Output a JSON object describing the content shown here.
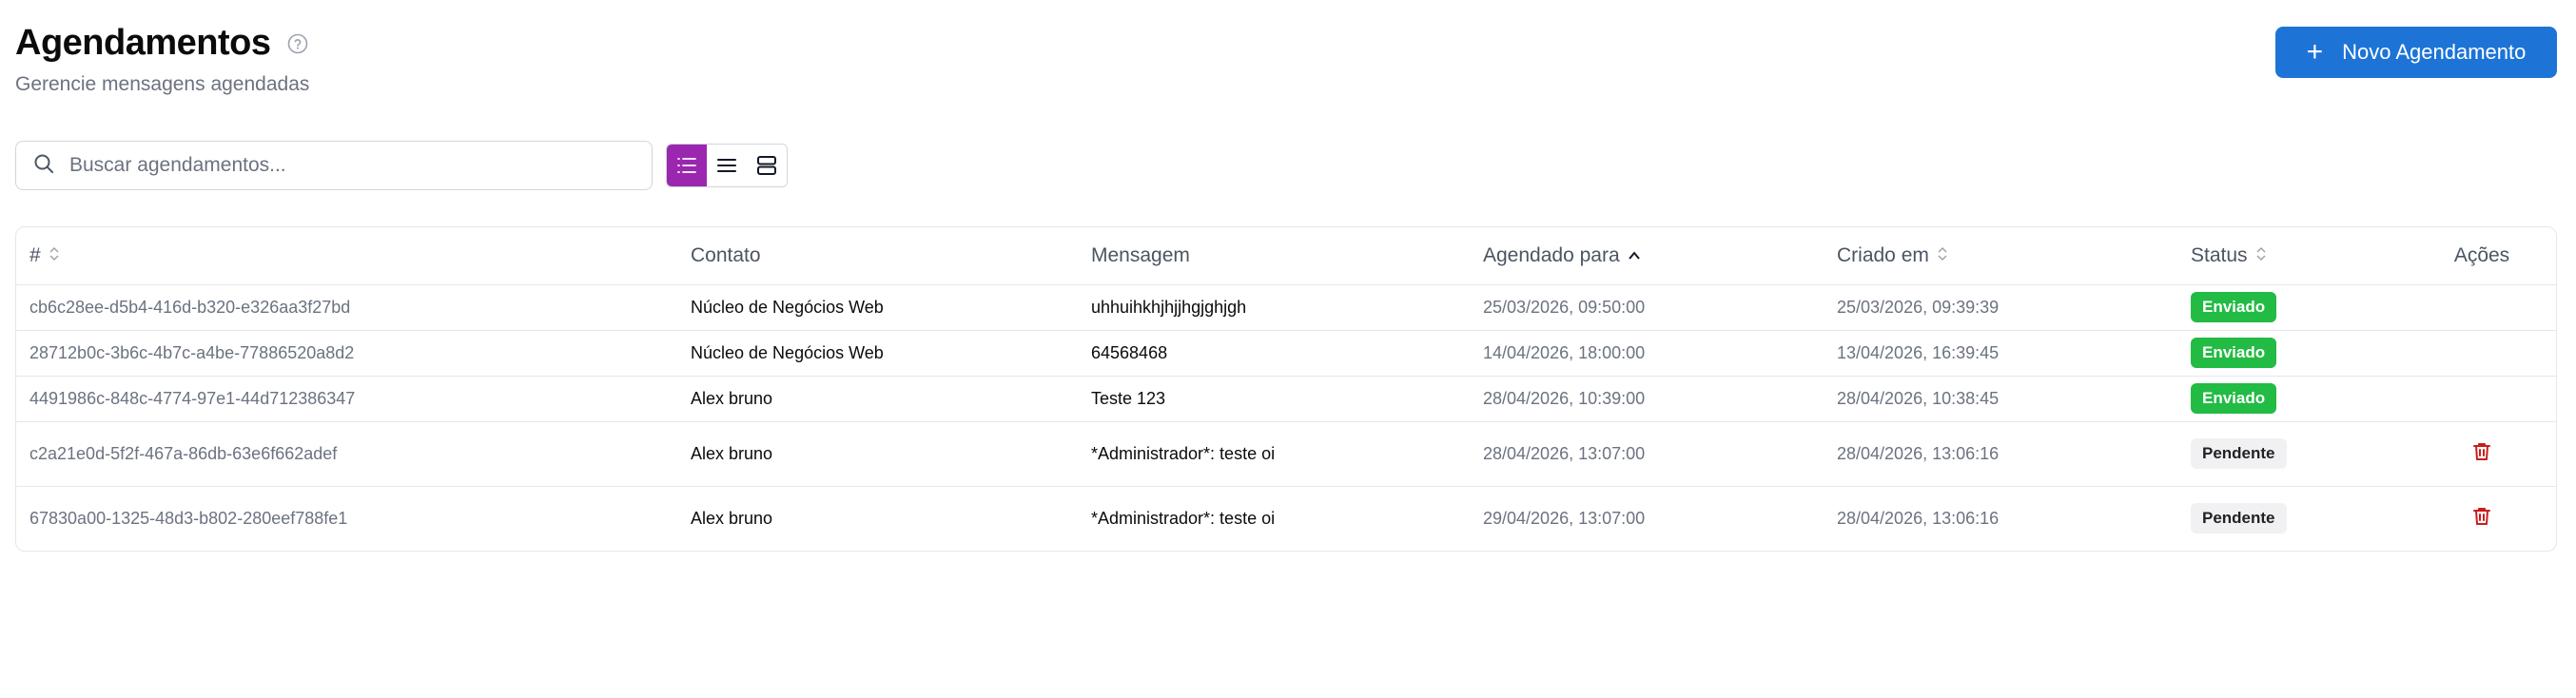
{
  "header": {
    "title": "Agendamentos",
    "subtitle": "Gerencie mensagens agendadas",
    "new_button_label": "Novo Agendamento"
  },
  "search": {
    "placeholder": "Buscar agendamentos...",
    "value": ""
  },
  "colors": {
    "primary": "#1d74d6",
    "view_active": "#9b27b0",
    "sent_badge": "#22bb44",
    "delete_icon": "#c81e1e"
  },
  "table": {
    "columns": [
      "#",
      "Contato",
      "Mensagem",
      "Agendado para",
      "Criado em",
      "Status",
      "Ações"
    ],
    "sorted_column": "Agendado para",
    "rows": [
      {
        "id": "cb6c28ee-d5b4-416d-b320-e326aa3f27bd",
        "contact": "Núcleo de Negócios Web",
        "message": "uhhuihkhjhjjhgjghjgh",
        "scheduled": "25/03/2026, 09:50:00",
        "created": "25/03/2026, 09:39:39",
        "status": "Enviado"
      },
      {
        "id": "28712b0c-3b6c-4b7c-a4be-77886520a8d2",
        "contact": "Núcleo de Negócios Web",
        "message": "64568468",
        "scheduled": "14/04/2026, 18:00:00",
        "created": "13/04/2026, 16:39:45",
        "status": "Enviado"
      },
      {
        "id": "4491986c-848c-4774-97e1-44d712386347",
        "contact": "Alex bruno",
        "message": "Teste 123",
        "scheduled": "28/04/2026, 10:39:00",
        "created": "28/04/2026, 10:38:45",
        "status": "Enviado"
      },
      {
        "id": "c2a21e0d-5f2f-467a-86db-63e6f662adef",
        "contact": "Alex bruno",
        "message": "*Administrador*: teste oi",
        "scheduled": "28/04/2026, 13:07:00",
        "created": "28/04/2026, 13:06:16",
        "status": "Pendente"
      },
      {
        "id": "67830a00-1325-48d3-b802-280eef788fe1",
        "contact": "Alex bruno",
        "message": "*Administrador*: teste oi",
        "scheduled": "29/04/2026, 13:07:00",
        "created": "28/04/2026, 13:06:16",
        "status": "Pendente"
      }
    ]
  }
}
